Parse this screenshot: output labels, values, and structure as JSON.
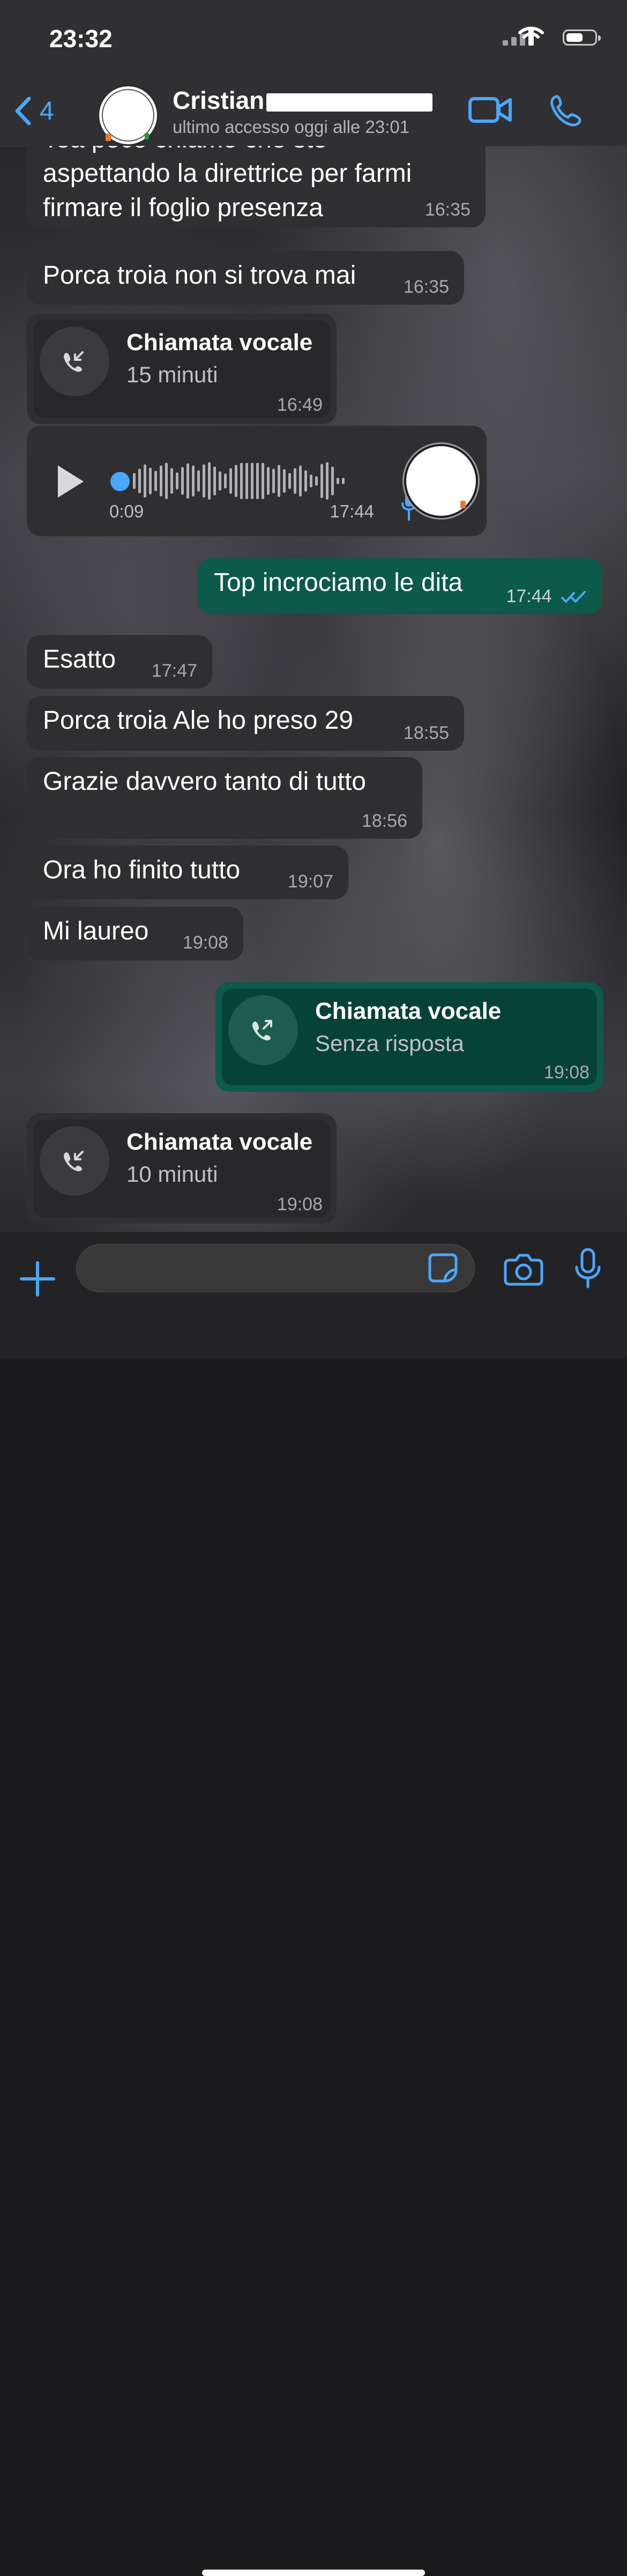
{
  "status_bar": {
    "time": "23:32"
  },
  "header": {
    "back_count": "4",
    "contact_name_visible": "Cristian",
    "last_seen": "ultimo accesso oggi alle 23:01"
  },
  "messages": [
    {
      "direction": "incoming",
      "text": "firmare il foglio presenza",
      "partial_lines": [
        "aspettando la direttrice per farmi"
      ],
      "time": "16:35"
    },
    {
      "direction": "incoming",
      "text": "Porca troia non si trova mai",
      "time": "16:35"
    },
    {
      "direction": "incoming",
      "type": "call",
      "title": "Chiamata vocale",
      "subtitle": "15 minuti",
      "time": "16:49"
    },
    {
      "direction": "incoming",
      "type": "voice",
      "duration": "0:09",
      "time": "17:44"
    },
    {
      "direction": "outgoing",
      "text": "Top incrociamo le dita",
      "time": "17:44"
    },
    {
      "direction": "incoming",
      "text": "Esatto",
      "time": "17:47"
    },
    {
      "direction": "incoming",
      "text": "Porca troia Ale ho preso 29",
      "time": "18:55"
    },
    {
      "direction": "incoming",
      "text": "Grazie davvero tanto di tutto",
      "time": "18:56"
    },
    {
      "direction": "incoming",
      "text": "Ora ho finito tutto",
      "time": "19:07"
    },
    {
      "direction": "incoming",
      "text": "Mi laureo",
      "time": "19:08"
    },
    {
      "direction": "outgoing",
      "type": "call",
      "title": "Chiamata vocale",
      "subtitle": "Senza risposta",
      "time": "19:08"
    },
    {
      "direction": "incoming",
      "type": "call",
      "title": "Chiamata vocale",
      "subtitle": "10 minuti",
      "time": "19:08"
    }
  ],
  "colors": {
    "accent_blue": "#4aa7ff",
    "incoming_bubble": "#2f2f32",
    "outgoing_bubble": "#0b5a4a",
    "header_bg": "#303033"
  },
  "icons": {
    "back": "chevron-left-icon",
    "video": "video-camera-icon",
    "phone": "phone-icon",
    "plus": "plus-icon",
    "sticker": "sticker-icon",
    "camera": "camera-icon",
    "mic": "microphone-icon"
  }
}
